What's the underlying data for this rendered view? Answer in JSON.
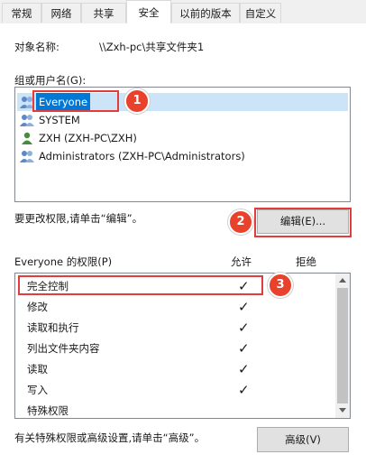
{
  "tabs": [
    "常规",
    "网络",
    "共享",
    "安全",
    "以前的版本",
    "自定义"
  ],
  "active_tab": "安全",
  "object_name_label": "对象名称:",
  "object_name_value": "\\\\Zxh-pc\\共享文件夹1",
  "groups_label": "组或用户名(G):",
  "users": [
    {
      "name": "Everyone",
      "selected": true
    },
    {
      "name": "SYSTEM"
    },
    {
      "name": "ZXH (ZXH-PC\\ZXH)"
    },
    {
      "name": "Administrators (ZXH-PC\\Administrators)"
    }
  ],
  "change_hint": "要更改权限,请单击“编辑”。",
  "edit_button": "编辑(E)...",
  "permissions_label": "Everyone 的权限(P)",
  "col_allow": "允许",
  "col_deny": "拒绝",
  "permissions": [
    {
      "name": "完全控制",
      "allow": "✓"
    },
    {
      "name": "修改",
      "allow": "✓"
    },
    {
      "name": "读取和执行",
      "allow": "✓"
    },
    {
      "name": "列出文件夹内容",
      "allow": "✓"
    },
    {
      "name": "读取",
      "allow": "✓"
    },
    {
      "name": "写入",
      "allow": "✓"
    },
    {
      "name": "特殊权限",
      "allow": ""
    }
  ],
  "advanced_hint": "有关特殊权限或高级设置,请单击“高级”。",
  "advanced_button": "高级(V)",
  "annotations": [
    "1",
    "2",
    "3"
  ],
  "colors": {
    "selection": "#0078d7",
    "annotation": "#e8412c"
  }
}
